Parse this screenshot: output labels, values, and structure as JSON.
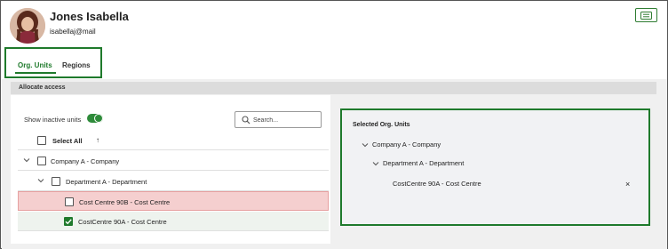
{
  "user": {
    "name": "Jones Isabella",
    "email": "isabellaj@mail"
  },
  "tabs": [
    {
      "label": "Org. Units",
      "active": true
    },
    {
      "label": "Regions",
      "active": false
    }
  ],
  "section": {
    "title": "Allocate access"
  },
  "left": {
    "toggle_label": "Show inactive units",
    "toggle_on": true,
    "search_placeholder": "Search...",
    "select_all_label": "Select All",
    "sort_icon": "↑",
    "rows": [
      {
        "label": "Company A - Company",
        "checked": false
      },
      {
        "label": "Department A - Department",
        "checked": false
      },
      {
        "label": "Cost Centre 90B - Cost Centre",
        "checked": false,
        "state": "error"
      },
      {
        "label": "CostCentre 90A - Cost Centre",
        "checked": true
      }
    ]
  },
  "right": {
    "title": "Selected Org. Units",
    "tree": [
      {
        "label": "Company A - Company"
      },
      {
        "label": "Department A - Department"
      },
      {
        "label": "CostCentre 90A - Cost Centre",
        "remove_label": "×"
      }
    ]
  },
  "colors": {
    "accent": "#1f7a2c",
    "error_row": "#f5cfcf",
    "panel_bg": "#f1f2f4"
  }
}
